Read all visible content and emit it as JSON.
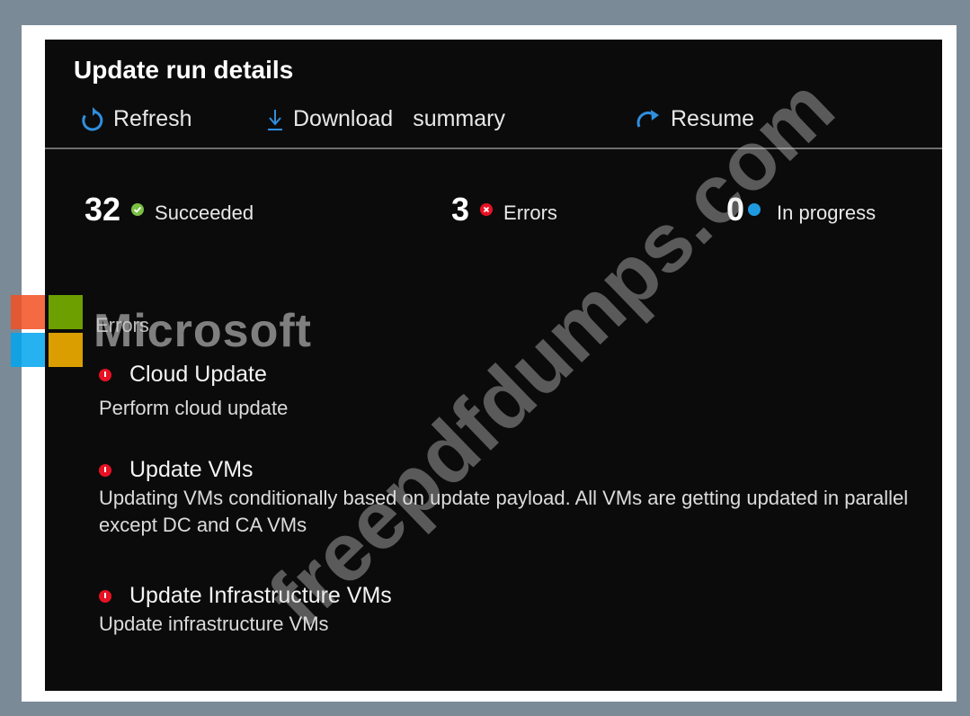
{
  "panel": {
    "title": "Update run details"
  },
  "toolbar": {
    "refresh_label": "Refresh",
    "download_label": "Download",
    "summary_label": "summary",
    "resume_label": "Resume"
  },
  "stats": {
    "succeeded": {
      "count": "32",
      "label": "Succeeded",
      "color": "#7ac043"
    },
    "errors": {
      "count": "3",
      "label": "Errors",
      "color": "#e81123"
    },
    "in_progress": {
      "count": "0",
      "label": "In progress",
      "color": "#1e9be0"
    }
  },
  "errors_section": {
    "heading": "Errors",
    "items": [
      {
        "title": "Cloud Update",
        "description": "Perform cloud update"
      },
      {
        "title": "Update VMs",
        "description": "Updating VMs conditionally based on update payload. All VMs are getting updated in parallel except DC and CA VMs"
      },
      {
        "title": "Update Infrastructure VMs",
        "description": "Update infrastructure VMs"
      }
    ]
  },
  "overlay": {
    "brand_text": "Microsoft",
    "watermark_text": "freepdfdumps.com"
  },
  "colors": {
    "accent_blue": "#2f8fde",
    "error_red": "#e81123",
    "panel_bg": "#0b0b0b"
  }
}
